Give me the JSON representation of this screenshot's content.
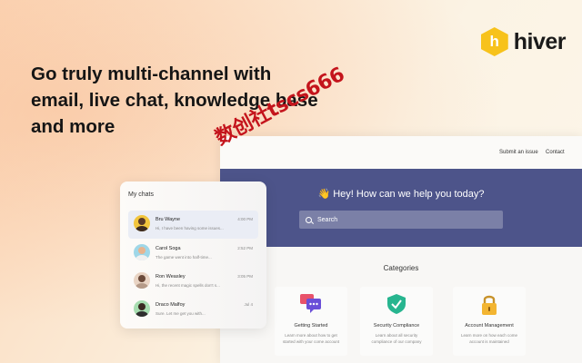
{
  "brand": {
    "name": "hiver",
    "colors": {
      "logo": "#f7c21b",
      "hero": "#4d548a"
    }
  },
  "headline": {
    "line1": "Go truly multi-channel with",
    "line2": "email, live chat, knowledge base",
    "line3": "and more"
  },
  "portal": {
    "nav": {
      "submit": "Submit an issue",
      "contact": "Contact"
    },
    "hero_title": "👋 Hey! How can we help you today?",
    "search_placeholder": "Search",
    "categories_title": "Categories",
    "categories": [
      {
        "title": "Getting Started",
        "desc": "Learn more about how to get started with your come account",
        "icon": "chat-bubbles-icon"
      },
      {
        "title": "Security Compliance",
        "desc": "Learn about all security compliance of our company",
        "icon": "shield-check-icon"
      },
      {
        "title": "Account Management",
        "desc": "Learn more on how each come account is maintained",
        "icon": "lock-icon"
      }
    ]
  },
  "chats": {
    "title": "My chats",
    "items": [
      {
        "name": "Bru Wayne",
        "message": "Hi, I have been having some issues...",
        "time": "4:00 PM"
      },
      {
        "name": "Carol Soga",
        "message": "The game went into half-time...",
        "time": "2:52 PM"
      },
      {
        "name": "Ron Weasley",
        "message": "Hi, the recent magic spells don't s...",
        "time": "3:05 PM"
      },
      {
        "name": "Draco Malfoy",
        "message": "Sure. Let me get you with...",
        "time": "Jul 4"
      }
    ]
  },
  "watermark": "数创社tscs666"
}
